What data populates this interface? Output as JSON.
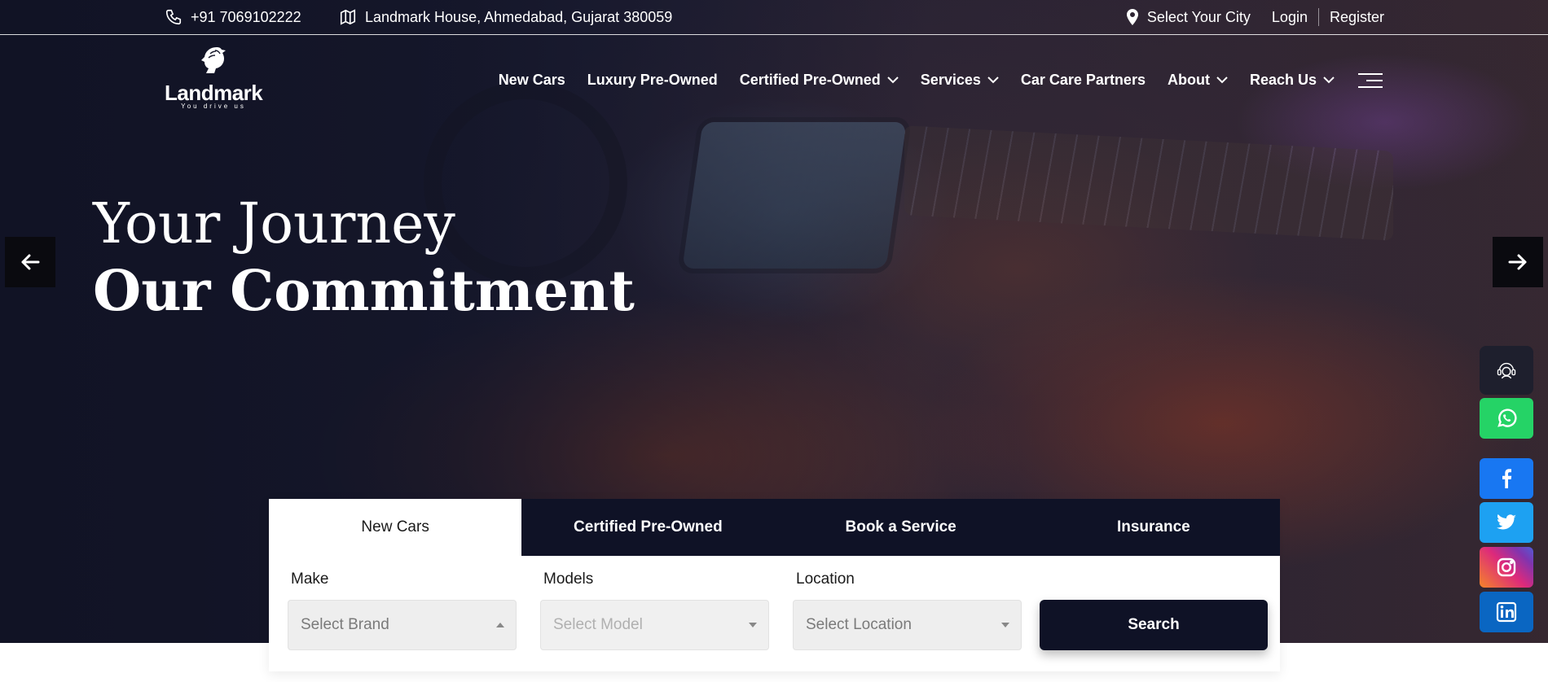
{
  "topbar": {
    "phone": "+91 7069102222",
    "address": "Landmark House, Ahmedabad, Gujarat 380059",
    "city": "Select Your City",
    "login": "Login",
    "register": "Register"
  },
  "brand": {
    "name": "Landmark",
    "tagline": "You drive us"
  },
  "nav": {
    "items": [
      {
        "label": "New Cars"
      },
      {
        "label": "Luxury Pre-Owned"
      },
      {
        "label": "Certified Pre-Owned"
      },
      {
        "label": "Services"
      },
      {
        "label": "Car Care Partners"
      },
      {
        "label": "About"
      },
      {
        "label": "Reach Us"
      }
    ]
  },
  "hero": {
    "line1": "Your Journey",
    "line2": "Our Commitment"
  },
  "search": {
    "tabs": [
      {
        "label": "New Cars"
      },
      {
        "label": "Certified Pre-Owned"
      },
      {
        "label": "Book a Service"
      },
      {
        "label": "Insurance"
      }
    ],
    "make_label": "Make",
    "make_placeholder": "Select Brand",
    "models_label": "Models",
    "models_placeholder": "Select Model",
    "location_label": "Location",
    "location_placeholder": "Select Location",
    "button": "Search"
  },
  "social": {
    "icons": [
      "assistant-icon",
      "whatsapp-icon",
      "facebook-icon",
      "twitter-icon",
      "instagram-icon",
      "linkedin-icon"
    ]
  },
  "colors": {
    "navy": "#0f1226",
    "whatsapp": "#25d366",
    "facebook": "#1877f2",
    "twitter": "#1da1f2",
    "linkedin": "#0a66c2"
  }
}
